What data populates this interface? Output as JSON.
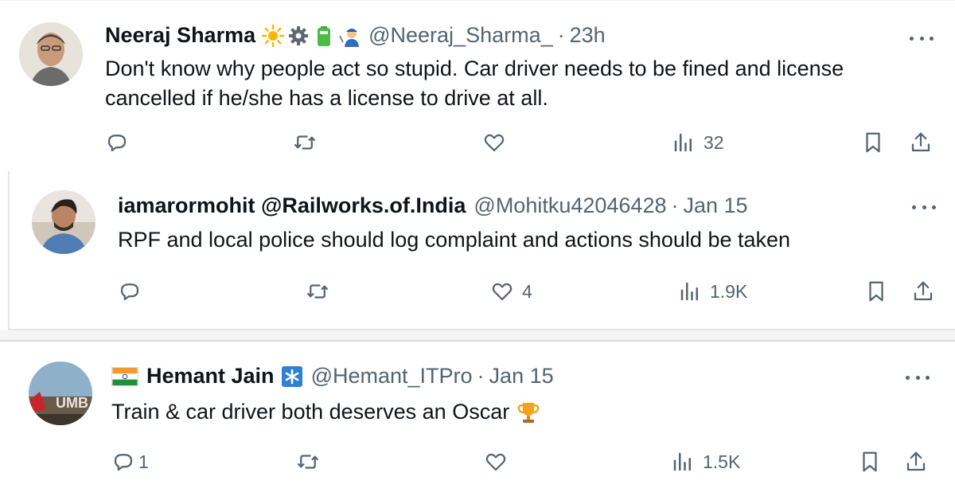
{
  "tweets": [
    {
      "name": "Neeraj Sharma",
      "handle": "@Neeraj_Sharma_",
      "time": "23h",
      "text": "Don't know why people act so stupid. Car driver needs to be fined and license cancelled if he/she has a license to drive at all.",
      "badges": [
        "sun-icon",
        "gear-icon",
        "battery-icon",
        "mechanic-icon"
      ],
      "stats": {
        "replies": "",
        "retweets": "",
        "likes": "",
        "views": "32"
      }
    },
    {
      "name": "iamarormohit @Railworks.of.India",
      "handle": "@Mohitku42046428",
      "time": "Jan 15",
      "text": "RPF and local police should log complaint and  actions should be taken",
      "stats": {
        "replies": "",
        "retweets": "",
        "likes": "4",
        "views": "1.9K"
      }
    },
    {
      "name": "Hemant Jain",
      "handle": "@Hemant_ITPro",
      "time": "Jan 15",
      "text": "Train & car driver both deserves an Oscar",
      "badges": [
        "india-flag-icon",
        "verified-asterisk-icon",
        "trophy-icon"
      ],
      "stats": {
        "replies": "1",
        "retweets": "",
        "likes": "",
        "views": "1.5K"
      }
    }
  ],
  "separator": "·",
  "colors": {
    "text": "#0f1419",
    "secondary": "#536471",
    "accent": "#1d9bf0"
  }
}
